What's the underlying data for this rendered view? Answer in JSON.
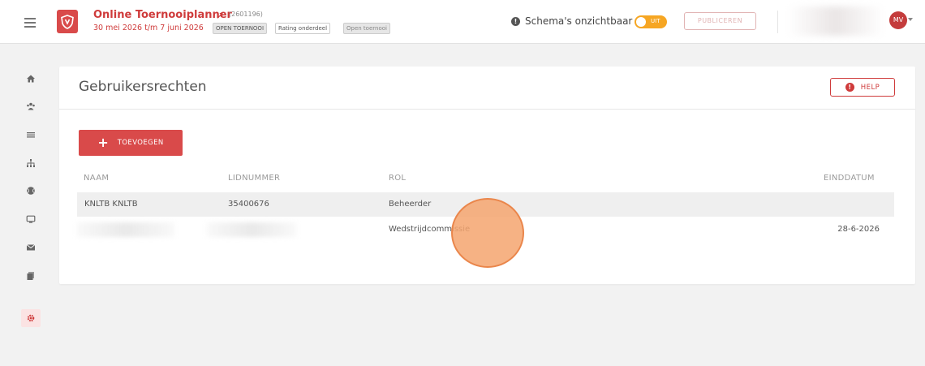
{
  "header": {
    "app_title": "Online Toernooiplanner",
    "tournament_id": "(2601196)",
    "dates": "30 mei 2026 t/m 7 juni 2026",
    "badges": [
      "OPEN TOERNOOI",
      "Rating onderdeel",
      "Open toernooi"
    ],
    "schema_label": "Schema's onzichtbaar",
    "toggle_label": "UIT",
    "publish_label": "PUBLICEREN",
    "avatar_initials": "MV"
  },
  "sidebar": {
    "items": [
      "home-icon",
      "users-icon",
      "list-icon",
      "hierarchy-icon",
      "ball-icon",
      "screen-icon",
      "mail-icon",
      "documents-icon",
      "settings-icon"
    ]
  },
  "page": {
    "title": "Gebruikersrechten",
    "help_label": "HELP",
    "add_label": "TOEVOEGEN",
    "columns": [
      "NAAM",
      "LIDNUMMER",
      "ROL",
      "EINDDATUM"
    ],
    "rows": [
      {
        "naam": "KNLTB KNLTB",
        "lidnummer": "35400676",
        "rol": "Beheerder",
        "einddatum": ""
      },
      {
        "naam": "",
        "lidnummer": "",
        "rol": "Wedstrijdcommissie",
        "einddatum": "28-6-2026"
      }
    ]
  },
  "colors": {
    "accent": "#d94a4a",
    "toggle": "#f6a623",
    "cursor_highlight": "#f5a56e"
  }
}
